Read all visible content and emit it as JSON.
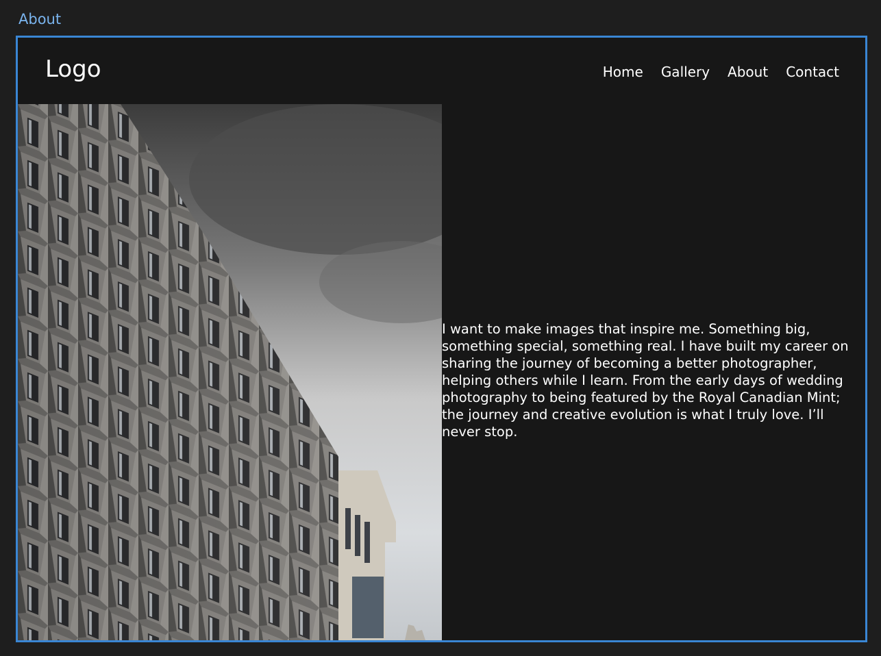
{
  "frame_label": "About",
  "header": {
    "logo": "Logo",
    "nav": [
      {
        "label": "Home"
      },
      {
        "label": "Gallery"
      },
      {
        "label": "About"
      },
      {
        "label": "Contact"
      }
    ]
  },
  "main": {
    "about_text": "  I want to make images that inspire me. Something big, something special, something real. I have built my career on sharing the journey of becoming a better photographer, helping others while I learn. From the early days of wedding photography to being featured by the Royal Canadian Mint; the journey and creative evolution is what I truly love. I’ll never stop."
  },
  "colors": {
    "frame_border": "#3a86d4",
    "frame_label": "#7ab4ee",
    "background": "#171717"
  }
}
